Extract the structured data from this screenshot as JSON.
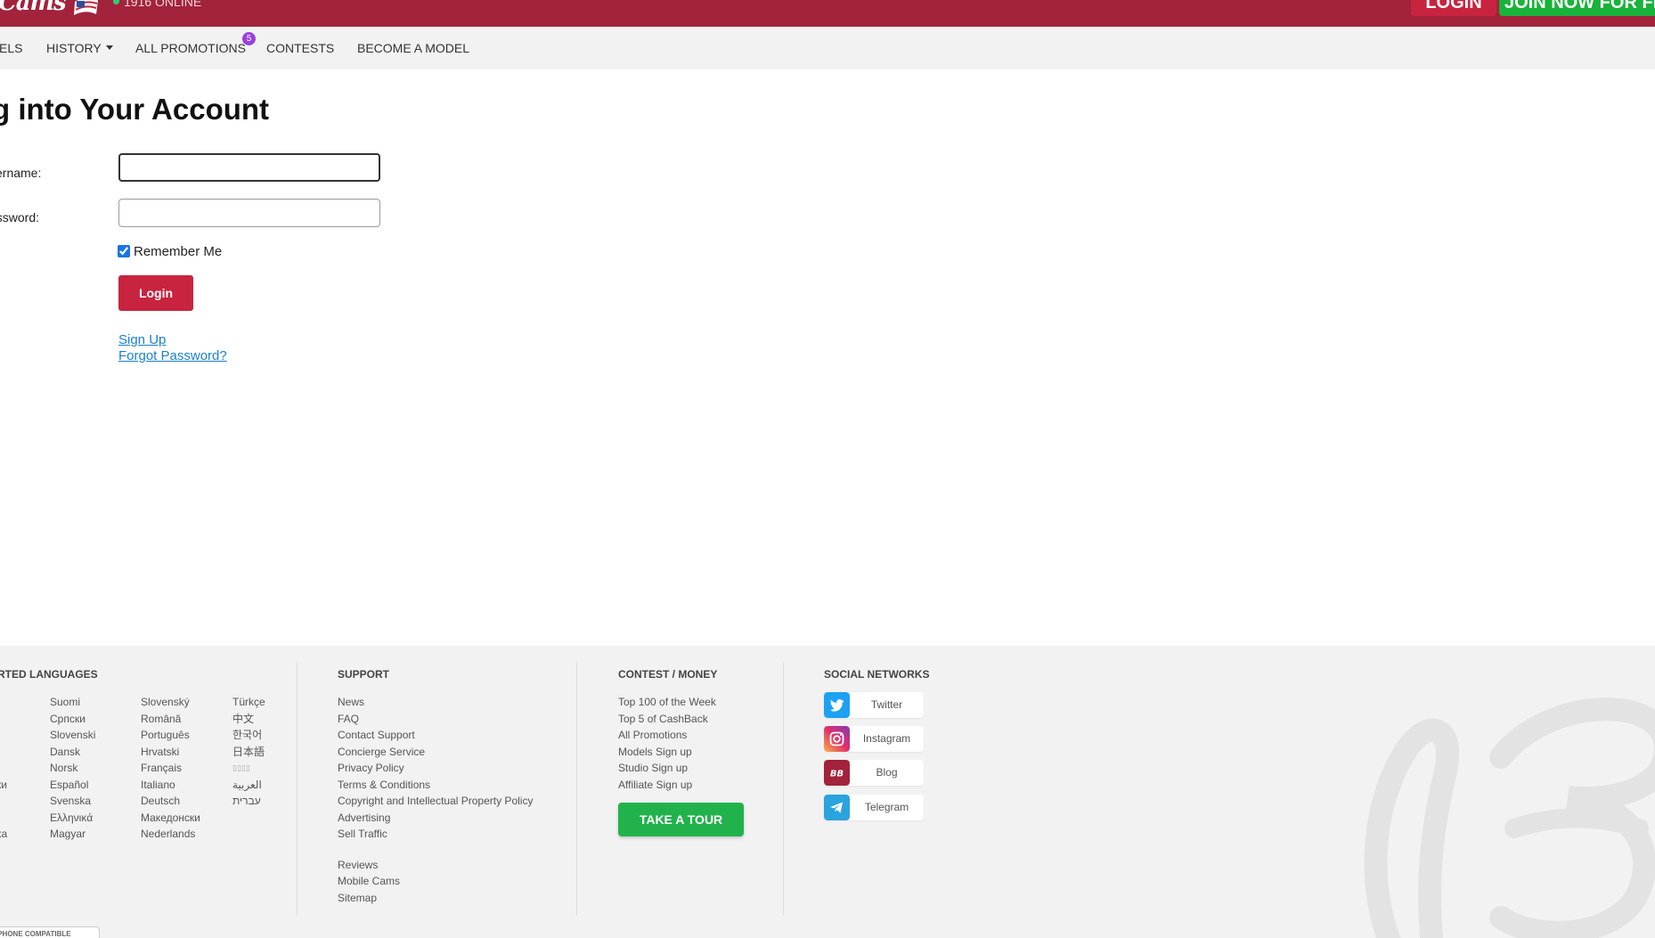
{
  "header": {
    "logo_text": "Cams",
    "online_text": "1916 ONLINE",
    "login_label": "LOGIN",
    "join_label": "JOIN NOW FOR FREE",
    "colors": {
      "bar": "#a2233b",
      "login": "#c8233f",
      "join": "#19b23a"
    }
  },
  "nav": {
    "items": [
      {
        "label": "ELS"
      },
      {
        "label": "HISTORY",
        "icon": "caret-down-icon"
      },
      {
        "label": "ALL PROMOTIONS",
        "badge": "5"
      },
      {
        "label": "CONTESTS"
      },
      {
        "label": "BECOME A MODEL"
      }
    ]
  },
  "login_form": {
    "title": "g into Your Account",
    "username_label": "sername:",
    "password_label": "assword:",
    "username_value": "",
    "password_value": "",
    "remember_label": "Remember Me",
    "remember_checked": true,
    "submit_label": "Login",
    "signup_link": "Sign Up",
    "forgot_link": "Forgot Password?"
  },
  "footer": {
    "languages": {
      "heading": "RTED LANGUAGES",
      "col0": [
        "",
        "",
        "",
        "",
        "",
        "ки",
        "",
        "",
        "ка"
      ],
      "col1": [
        "Suomi",
        "Српски",
        "Slovenski",
        "Dansk",
        "Norsk",
        "Español",
        "Svenska",
        "Ελληνικά",
        "Magyar"
      ],
      "col2": [
        "Slovenský",
        "Română",
        "Português",
        "Hrvatski",
        "Français",
        "Italiano",
        "Deutsch",
        "Македонски",
        "Nederlands"
      ],
      "col3": [
        "Türkçe",
        "中文",
        "한국어",
        "日本語",
        "▯▯▯▯",
        "العربية",
        "עברית"
      ]
    },
    "support": {
      "heading": "SUPPORT",
      "items": [
        "News",
        "FAQ",
        "Contact Support",
        "Concierge Service",
        "Privacy Policy",
        "Terms & Conditions",
        "Copyright and Intellectual Property Policy",
        "Advertising",
        "Sell Traffic"
      ],
      "items2": [
        "Reviews",
        "Mobile Cams",
        "Sitemap"
      ]
    },
    "contest": {
      "heading": "CONTEST / MONEY",
      "items": [
        "Top 100 of the Week",
        "Top 5 of CashBack",
        "All Promotions",
        "Models Sign up",
        "Studio Sign up",
        "Affiliate Sign up"
      ],
      "tour_label": "TAKE A TOUR"
    },
    "social": {
      "heading": "SOCIAL NETWORKS",
      "items": [
        {
          "label": "Twitter",
          "icon": "twitter-icon",
          "color": "#1da1f2"
        },
        {
          "label": "Instagram",
          "icon": "instagram-icon",
          "color": "#d6249f"
        },
        {
          "label": "Blog",
          "icon": "blog-icon",
          "color": "#a2233b"
        },
        {
          "label": "Telegram",
          "icon": "telegram-icon",
          "color": "#2aa3de"
        }
      ]
    },
    "iphone_badge": "IPHONE COMPATIBLE"
  }
}
